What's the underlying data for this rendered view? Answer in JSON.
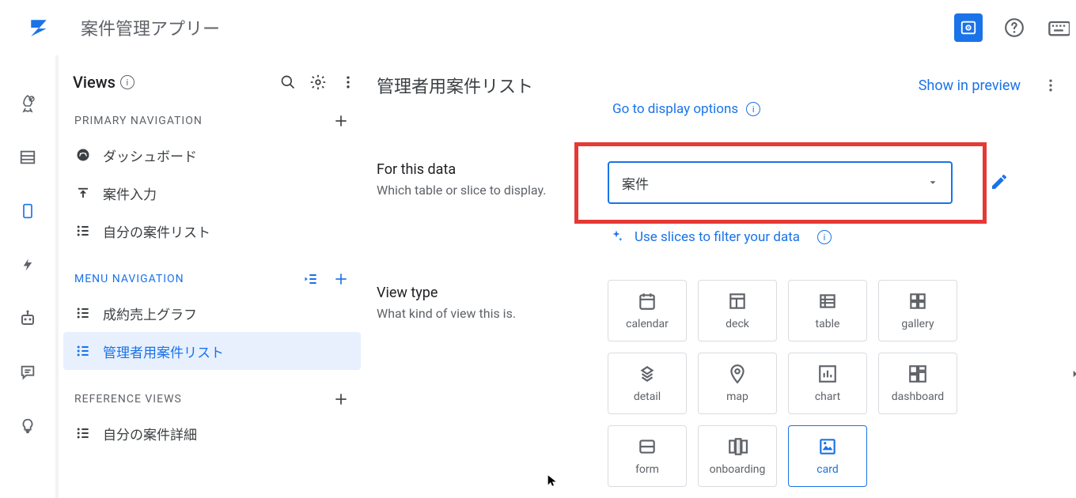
{
  "app_title": "案件管理アプリー",
  "views": {
    "title": "Views",
    "sections": {
      "primary": {
        "label": "PRIMARY NAVIGATION",
        "items": [
          {
            "label": "ダッシュボード",
            "icon": "dashboard-icon"
          },
          {
            "label": "案件入力",
            "icon": "upload-icon"
          },
          {
            "label": "自分の案件リスト",
            "icon": "list-icon"
          }
        ]
      },
      "menu": {
        "label": "MENU NAVIGATION",
        "items": [
          {
            "label": "成約売上グラフ",
            "icon": "list-icon"
          },
          {
            "label": "管理者用案件リスト",
            "icon": "list-icon",
            "selected": true
          }
        ]
      },
      "reference": {
        "label": "REFERENCE VIEWS",
        "items": [
          {
            "label": "自分の案件詳細",
            "icon": "list-icon"
          }
        ]
      }
    }
  },
  "detail": {
    "title": "管理者用案件リスト",
    "show_in_preview": "Show in preview",
    "go_to_display": "Go to display options",
    "for_this_data": {
      "label": "For this data",
      "desc": "Which table or slice to display.",
      "selected": "案件",
      "hint": "Use slices to filter your data"
    },
    "view_type": {
      "label": "View type",
      "desc": "What kind of view this is.",
      "options": [
        [
          "calendar",
          "deck",
          "table",
          "gallery"
        ],
        [
          "detail",
          "map",
          "chart",
          "dashboard"
        ],
        [
          "form",
          "onboarding",
          "card"
        ]
      ],
      "active": "card"
    }
  }
}
